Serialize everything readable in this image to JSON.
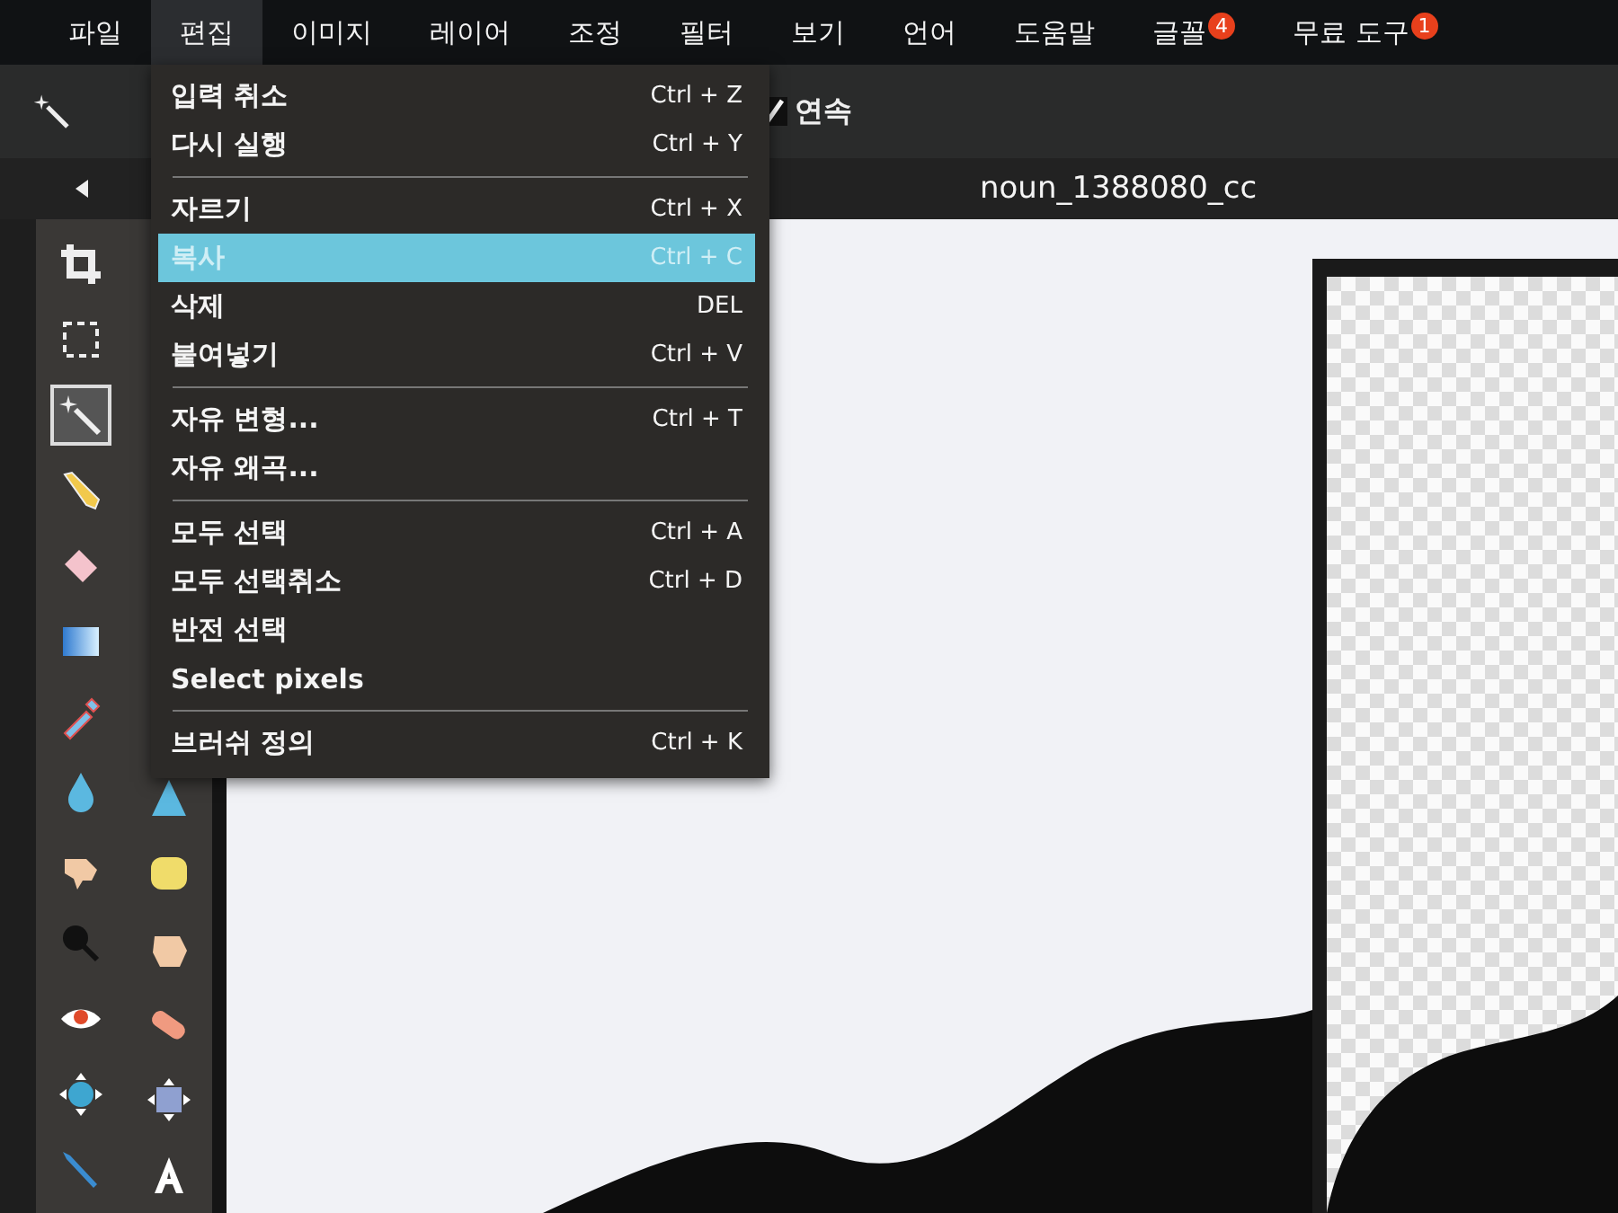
{
  "menu_bar": [
    {
      "label": "파일",
      "selected": false
    },
    {
      "label": "편집",
      "selected": true
    },
    {
      "label": "이미지",
      "selected": false
    },
    {
      "label": "레이어",
      "selected": false
    },
    {
      "label": "조정",
      "selected": false
    },
    {
      "label": "필터",
      "selected": false
    },
    {
      "label": "보기",
      "selected": false
    },
    {
      "label": "언어",
      "selected": false
    },
    {
      "label": "도움말",
      "selected": false
    },
    {
      "label": "글꼴",
      "selected": false,
      "badge": "4"
    },
    {
      "label": "무료 도구",
      "selected": false,
      "badge": "1"
    }
  ],
  "options_bar": {
    "continuous": {
      "label": "연속",
      "checked": true
    }
  },
  "document": {
    "title": "noun_1388080_cc"
  },
  "edit_menu": [
    {
      "kind": "item",
      "label": "입력 취소",
      "shortcut": "Ctrl + Z",
      "selected": false
    },
    {
      "kind": "item",
      "label": "다시 실행",
      "shortcut": "Ctrl + Y",
      "selected": false
    },
    {
      "kind": "separator"
    },
    {
      "kind": "item",
      "label": "자르기",
      "shortcut": "Ctrl + X",
      "selected": false
    },
    {
      "kind": "item",
      "label": "복사",
      "shortcut": "Ctrl + C",
      "selected": true
    },
    {
      "kind": "item",
      "label": "삭제",
      "shortcut": "DEL",
      "selected": false
    },
    {
      "kind": "item",
      "label": "붙여넣기",
      "shortcut": "Ctrl + V",
      "selected": false
    },
    {
      "kind": "separator"
    },
    {
      "kind": "item",
      "label": "자유 변형...",
      "shortcut": "Ctrl + T",
      "selected": false
    },
    {
      "kind": "item",
      "label": "자유 왜곡...",
      "selected": false
    },
    {
      "kind": "separator"
    },
    {
      "kind": "item",
      "label": "모두 선택",
      "shortcut": "Ctrl + A",
      "selected": false
    },
    {
      "kind": "item",
      "label": "모두 선택취소",
      "shortcut": "Ctrl + D",
      "selected": false
    },
    {
      "kind": "item",
      "label": "반전 선택",
      "selected": false
    },
    {
      "kind": "item",
      "label": "Select pixels",
      "selected": false
    },
    {
      "kind": "separator"
    },
    {
      "kind": "item",
      "label": "브러쉬 정의",
      "shortcut": "Ctrl + K",
      "selected": false
    }
  ],
  "tools_left": [
    {
      "kind": "crop",
      "selected": false
    },
    {
      "kind": "marquee",
      "selected": false
    },
    {
      "kind": "wand",
      "selected": true
    },
    {
      "kind": "pencil",
      "selected": false
    },
    {
      "kind": "eraser",
      "selected": false
    },
    {
      "kind": "gradient",
      "selected": false
    },
    {
      "kind": "picker",
      "selected": false
    },
    {
      "kind": "drop",
      "selected": false
    },
    {
      "kind": "smudge",
      "selected": false
    },
    {
      "kind": "burn",
      "selected": false
    },
    {
      "kind": "redeye",
      "selected": false
    },
    {
      "kind": "move",
      "selected": false
    },
    {
      "kind": "brush",
      "selected": false
    }
  ],
  "tools_right": [
    {
      "kind": "sharpen",
      "selected": false
    },
    {
      "kind": "sponge",
      "selected": false
    },
    {
      "kind": "dodge",
      "selected": false
    },
    {
      "kind": "bandage",
      "selected": false
    },
    {
      "kind": "transform",
      "selected": false
    },
    {
      "kind": "text",
      "selected": false
    }
  ]
}
